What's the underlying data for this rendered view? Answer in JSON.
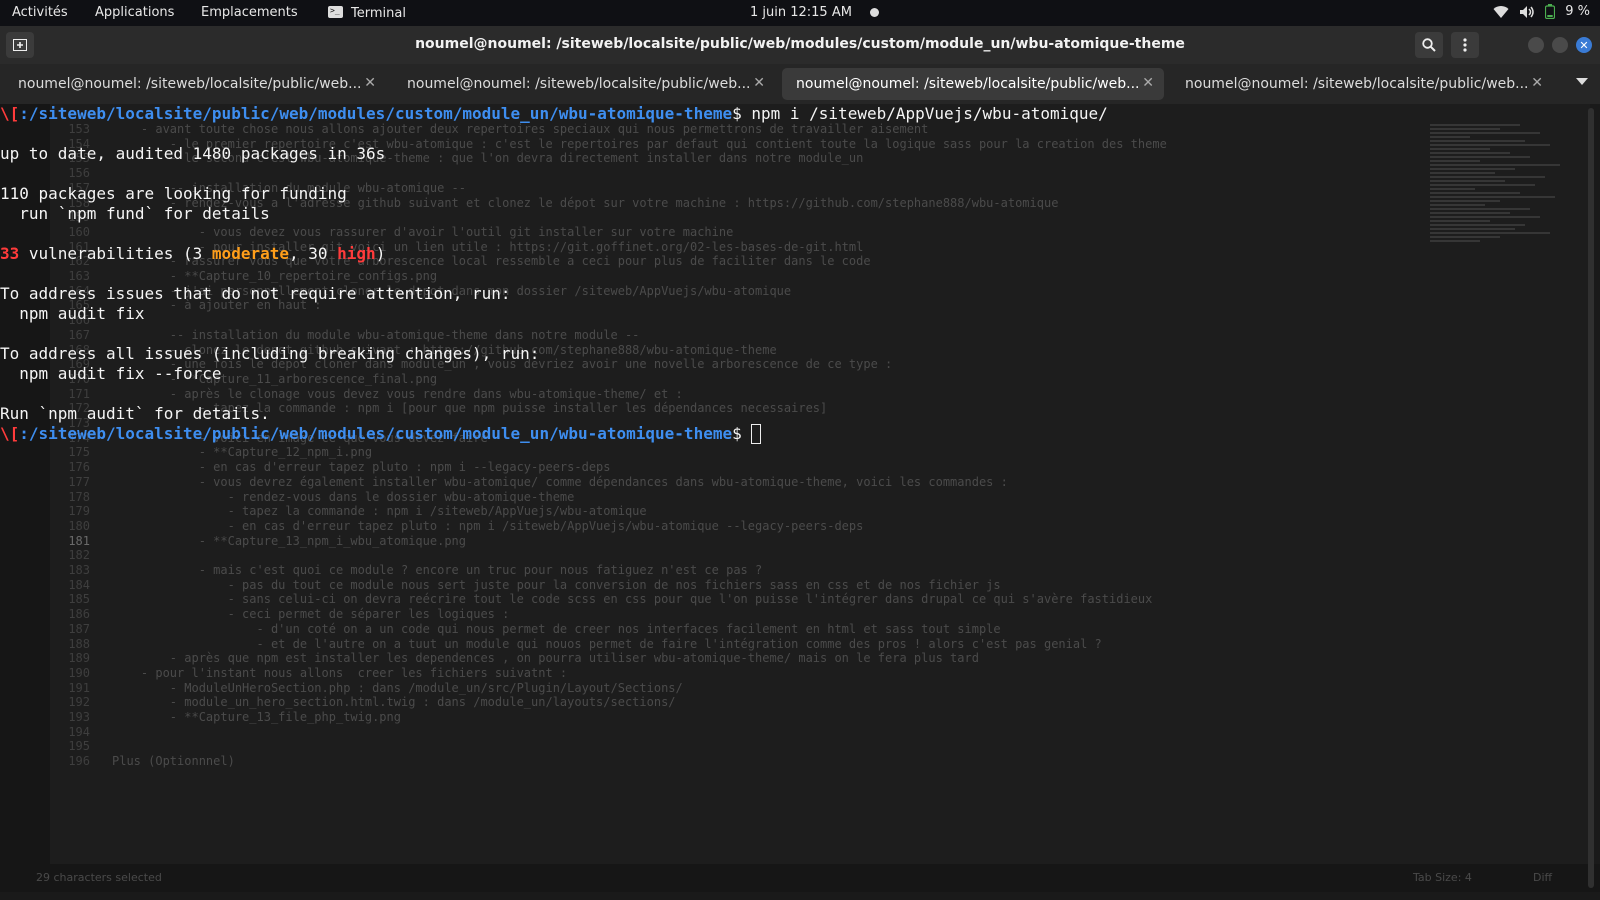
{
  "topbar": {
    "activities": "Activités",
    "applications": "Applications",
    "places": "Emplacements",
    "terminal_app": "Terminal",
    "clock": "1 juin  12:15 AM",
    "battery": "9 %"
  },
  "window": {
    "title": "noumel@noumel: /siteweb/localsite/public/web/modules/custom/module_un/wbu-atomique-theme"
  },
  "tabs": [
    {
      "label": "noumel@noumel: /siteweb/localsite/public/web..."
    },
    {
      "label": "noumel@noumel: /siteweb/localsite/public/web..."
    },
    {
      "label": "noumel@noumel: /siteweb/localsite/public/web..."
    },
    {
      "label": "noumel@noumel: /siteweb/localsite/public/web..."
    }
  ],
  "terminal": {
    "prompt_prefix": "\\[",
    "prompt_path": ":/siteweb/localsite/public/web/modules/custom/module_un/wbu-atomique-theme",
    "prompt_symbol": "$ ",
    "command": "npm i /siteweb/AppVuejs/wbu-atomique/",
    "up_to_date": "up to date, audited 1480 packages in 36s",
    "funding_1": "110 packages are looking for funding",
    "funding_2": "  run `npm fund` for details",
    "vuln_count": "33",
    "vuln_text_1": " vulnerabilities (3 ",
    "vuln_moderate": "moderate",
    "vuln_text_2": ", 30 ",
    "vuln_high": "high",
    "vuln_text_3": ")",
    "address_1": "To address issues that do not require attention, run:",
    "address_1_cmd": "  npm audit fix",
    "address_2": "To address all issues (including breaking changes), run:",
    "address_2_cmd": "  npm audit fix --force",
    "run_audit": "Run `npm audit` for details."
  },
  "editor_ghost": {
    "lines": [
      {
        "n": "153",
        "t": "    - avant toute chose nous allons ajouter deux repertoires speciaux qui nous permettrons de travailler aisement"
      },
      {
        "n": "154",
        "t": "        - le premier repertoire c'est wbu-atomique : c'est le repertoires par defaut qui contient toute la logique sass pour la creation des theme"
      },
      {
        "n": "155",
        "t": "        - le second c'est wbu-atomique-theme : que l'on devra directement installer dans notre module_un"
      },
      {
        "n": "156",
        "t": ""
      },
      {
        "n": "157",
        "t": "        -- installation du module wbu-atomique --"
      },
      {
        "n": "158",
        "t": "        - rendez-vous a l'adresse github suivant et clonez le dépot sur votre machine : https://github.com/stephane888/wbu-atomique"
      },
      {
        "n": "159",
        "t": ""
      },
      {
        "n": "160",
        "t": "            - vous devez vous rassurer d'avoir l'outil git installer sur votre machine"
      },
      {
        "n": "161",
        "t": "            - pour installer git voici un lien utile : https://git.goffinet.org/02-les-bases-de-git.html"
      },
      {
        "n": "162",
        "t": "        - rassurer vous que votre arborescence local ressemble a ceci pour plus de faciliter dans le code"
      },
      {
        "n": "163",
        "t": "        - **Capture_10_repertoire_configs.png"
      },
      {
        "n": "164",
        "t": "        - j'ai personnellement cloner le depot dans mon dossier /siteweb/AppVuejs/wbu-atomique"
      },
      {
        "n": "165",
        "t": "        - à ajouter en haut :"
      },
      {
        "n": "166",
        "t": ""
      },
      {
        "n": "167",
        "t": "        -- installation du module wbu-atomique-theme dans notre module --"
      },
      {
        "n": "168",
        "t": "        - clonez le depot github suivant : https://github.com/stephane888/wbu-atomique-theme"
      },
      {
        "n": "169",
        "t": "        - une fois le depot cloner dans module_un , vous devriez avoir une novelle arborescence de ce type :"
      },
      {
        "n": "170",
        "t": "        - **Capture_11_arborescence_final.png"
      },
      {
        "n": "171",
        "t": "        - après le clonage vous devez vous rendre dans wbu-atomique-theme/ et :"
      },
      {
        "n": "172",
        "t": "            - tapez la commande : npm i [pour que npm puisse installer les dépendances necessaires]"
      },
      {
        "n": "173",
        "t": ""
      },
      {
        "n": "174",
        "t": "            - voici en image ce que vous devez faire"
      },
      {
        "n": "175",
        "t": "            - **Capture_12_npm_i.png"
      },
      {
        "n": "176",
        "t": "            - en cas d'erreur tapez pluto : npm i --legacy-peers-deps"
      },
      {
        "n": "177",
        "t": "            - vous devrez également installer wbu-atomique/ comme dépendances dans wbu-atomique-theme, voici les commandes :"
      },
      {
        "n": "178",
        "t": "                - rendez-vous dans le dossier wbu-atomique-theme"
      },
      {
        "n": "179",
        "t": "                - tapez la commande : npm i /siteweb/AppVuejs/wbu-atomique"
      },
      {
        "n": "180",
        "t": "                - en cas d'erreur tapez pluto : npm i /siteweb/AppVuejs/wbu-atomique --legacy-peers-deps"
      },
      {
        "n": "181",
        "t": "            - **Capture_13_npm_i_wbu_atomique.png"
      },
      {
        "n": "182",
        "t": ""
      },
      {
        "n": "183",
        "t": "            - mais c'est quoi ce module ? encore un truc pour nous fatiguez n'est ce pas ?"
      },
      {
        "n": "184",
        "t": "                - pas du tout ce module nous sert juste pour la conversion de nos fichiers sass en css et de nos fichier js"
      },
      {
        "n": "185",
        "t": "                - sans celui-ci on devra reécrire tout le code scss en css pour que l'on puisse l'intégrer dans drupal ce qui s'avère fastidieux"
      },
      {
        "n": "186",
        "t": "                - ceci permet de séparer les logiques :"
      },
      {
        "n": "187",
        "t": "                    - d'un coté on a un code qui nous permet de creer nos interfaces facilement en html et sass tout simple"
      },
      {
        "n": "188",
        "t": "                    - et de l'autre on a tuut un module qui nouos permet de faire l'intégration comme des pros ! alors c'est pas genial ?"
      },
      {
        "n": "189",
        "t": "        - après que npm est installer les dependences , on pourra utiliser wbu-atomique-theme/ mais on le fera plus tard"
      },
      {
        "n": "190",
        "t": "    - pour l'instant nous allons  creer les fichiers suivatnt :"
      },
      {
        "n": "191",
        "t": "        - ModuleUnHeroSection.php : dans /module_un/src/Plugin/Layout/Sections/"
      },
      {
        "n": "192",
        "t": "        - module_un_hero_section.html.twig : dans /module_un/layouts/sections/"
      },
      {
        "n": "193",
        "t": "        - **Capture_13_file_php_twig.png"
      },
      {
        "n": "194",
        "t": ""
      },
      {
        "n": "195",
        "t": ""
      },
      {
        "n": "196",
        "t": "Plus (Optionnnel)"
      }
    ],
    "status_selected": "29 characters selected",
    "status_tab": "Tab Size: 4",
    "status_diff": "Diff"
  },
  "colors": {
    "prompt_path": "#3e8ef0",
    "prompt_prefix": "#ff3b3b",
    "vuln_moderate": "#ff9e1a",
    "vuln_high": "#ff3b3b",
    "active_tab": "#3a3a3a",
    "close_button": "#3a7bd5"
  },
  "icons": {
    "new_tab": "new-tab-icon",
    "search": "search-icon",
    "menu": "kebab-menu-icon",
    "wifi": "wifi-icon",
    "volume": "volume-icon",
    "battery": "battery-icon"
  }
}
